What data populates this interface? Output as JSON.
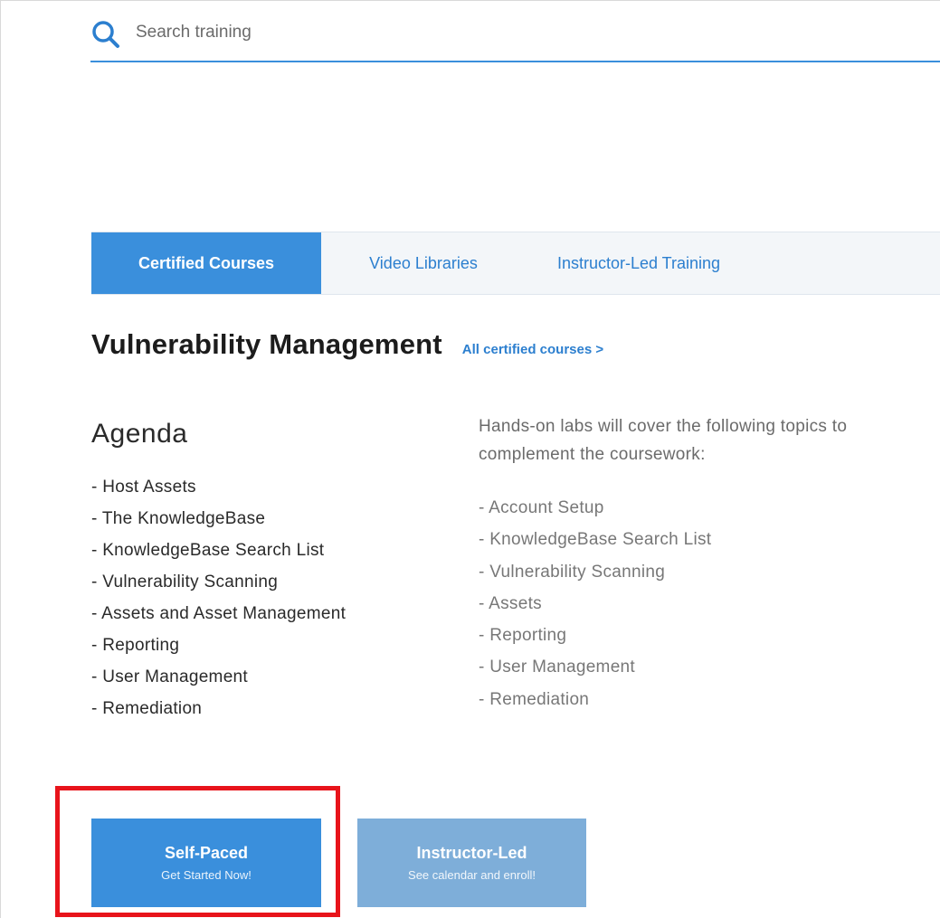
{
  "search": {
    "placeholder": "Search training"
  },
  "tabs": [
    {
      "label": "Certified Courses",
      "active": true
    },
    {
      "label": "Video Libraries",
      "active": false
    },
    {
      "label": "Instructor-Led Training",
      "active": false
    }
  ],
  "page": {
    "title": "Vulnerability Management",
    "all_courses_link": "All certified courses >"
  },
  "agenda": {
    "title": "Agenda",
    "items": [
      "- Host Assets",
      "- The KnowledgeBase",
      "- KnowledgeBase Search List",
      "- Vulnerability Scanning",
      "- Assets and Asset Management",
      "- Reporting",
      "- User Management",
      "- Remediation"
    ]
  },
  "labs": {
    "intro": "Hands-on labs will cover the following topics to complement the coursework:",
    "items": [
      "- Account Setup",
      "- KnowledgeBase Search List",
      "- Vulnerability Scanning",
      "- Assets",
      "- Reporting",
      "- User Management",
      "- Remediation"
    ]
  },
  "buttons": {
    "self_paced": {
      "title": "Self-Paced",
      "subtitle": "Get Started Now!"
    },
    "instructor_led": {
      "title": "Instructor-Led",
      "subtitle": "See calendar and enroll!"
    }
  },
  "icons": {
    "search": "search-icon"
  },
  "colors": {
    "accent": "#3a8fdc",
    "link": "#2c7fcf",
    "instructor_button": "#7eaed9",
    "highlight": "#e8141b"
  }
}
